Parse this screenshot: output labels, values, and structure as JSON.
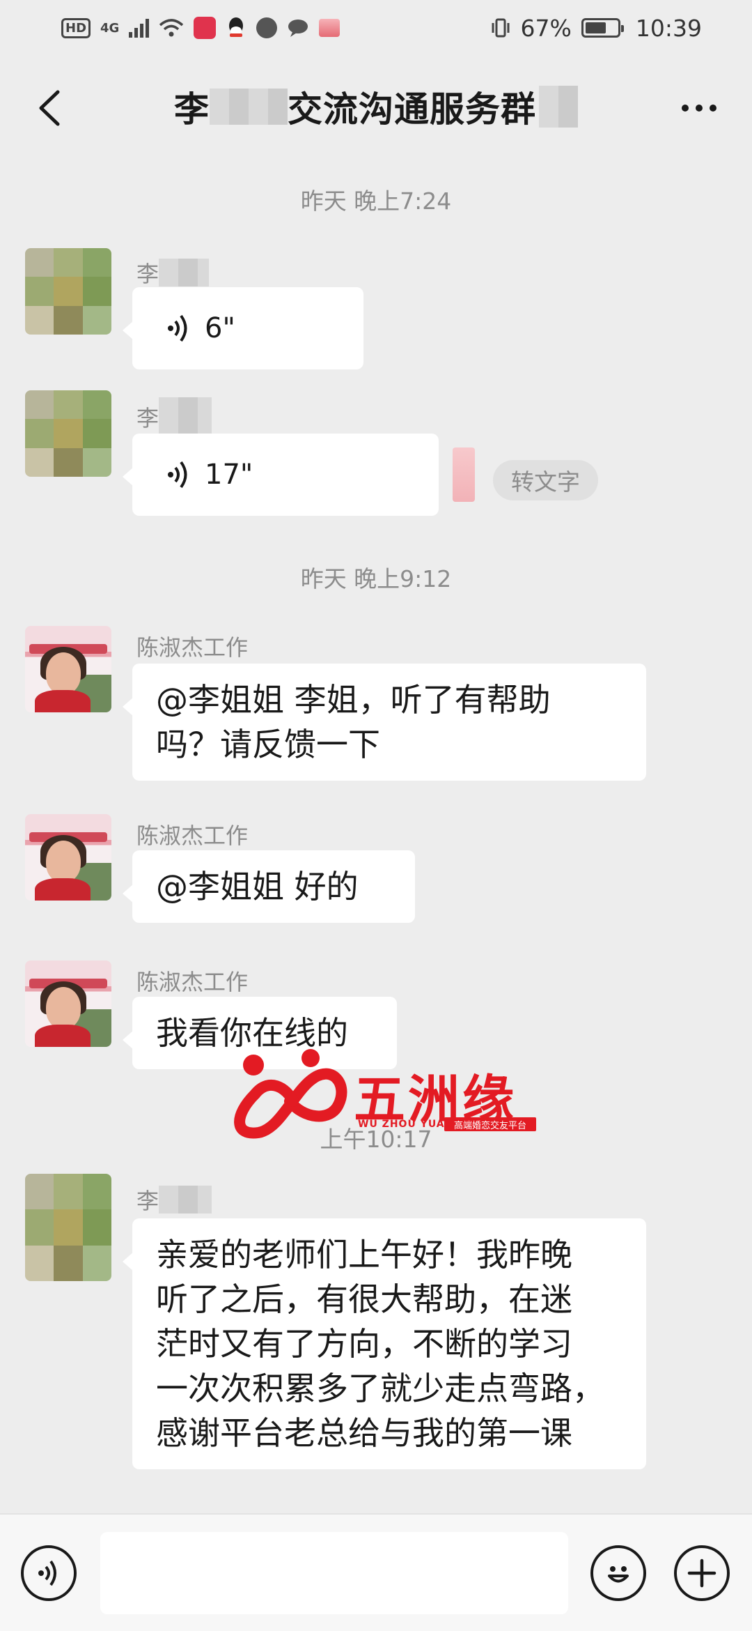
{
  "status_bar": {
    "network": "4G",
    "hd": "HD",
    "battery": "67%",
    "battery_level": 0.67,
    "time": "10:39"
  },
  "header": {
    "title_part1": "李",
    "title_part2": "交流沟通服务群",
    "back_icon": "chevron-left-icon",
    "more_icon": "more-dots-icon"
  },
  "messages": [
    {
      "type": "time",
      "text": "昨天 晚上7:24"
    },
    {
      "type": "voice",
      "sender": "李",
      "duration": "6\""
    },
    {
      "type": "voice",
      "sender": "李",
      "duration": "17\"",
      "action": "转文字"
    },
    {
      "type": "time",
      "text": "昨天 晚上9:12"
    },
    {
      "type": "text",
      "sender": "陈淑杰工作",
      "lines": [
        "@李姐姐  李姐，听了有帮助",
        "吗？请反馈一下"
      ]
    },
    {
      "type": "text",
      "sender": "陈淑杰工作",
      "lines": [
        "@李姐姐  好的"
      ]
    },
    {
      "type": "text",
      "sender": "陈淑杰工作",
      "lines": [
        "我看你在线的"
      ]
    },
    {
      "type": "time",
      "text": "上午10:17"
    },
    {
      "type": "text",
      "sender": "李",
      "lines": [
        "亲爱的老师们上午好！我昨晚",
        "听了之后，有很大帮助，在迷",
        "茫时又有了方向，不断的学习",
        "一次次积累多了就少走点弯路，",
        "感谢平台老总给与我的第一课"
      ]
    }
  ],
  "watermark": {
    "title": "五洲缘",
    "english": "WU ZHOU YUAN",
    "tagline": "高端婚恋交友平台"
  },
  "input_bar": {
    "voice_icon": "voice-mode-icon",
    "emoji_icon": "emoji-icon",
    "plus_icon": "plus-icon",
    "placeholder": ""
  },
  "colors": {
    "background": "#ededed",
    "bubble": "#ffffff",
    "watermark": "#e31b23"
  }
}
